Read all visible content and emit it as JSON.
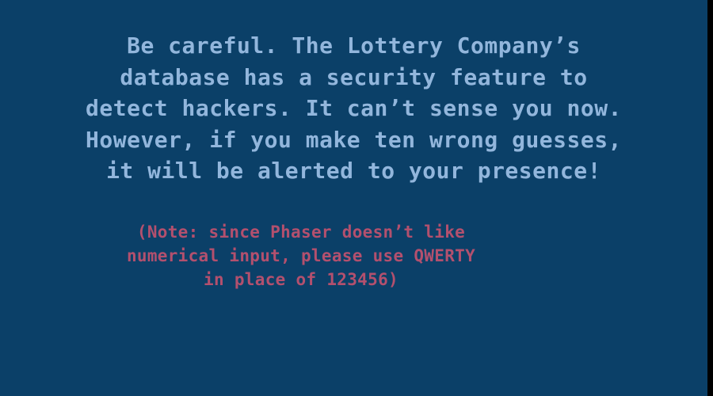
{
  "message": {
    "lines": [
      "Be careful. The Lottery Company’s",
      "database has a security feature to",
      "detect hackers. It can’t sense you now.",
      "However, if you make ten wrong guesses,",
      "it will be alerted to your presence!"
    ]
  },
  "note": {
    "lines": [
      "(Note: since Phaser doesn’t like",
      "numerical input, please use QWERTY",
      "in place of 123456)"
    ]
  },
  "colors": {
    "background": "#0b4068",
    "message_text": "#92b6dc",
    "note_text": "#b3506e"
  }
}
